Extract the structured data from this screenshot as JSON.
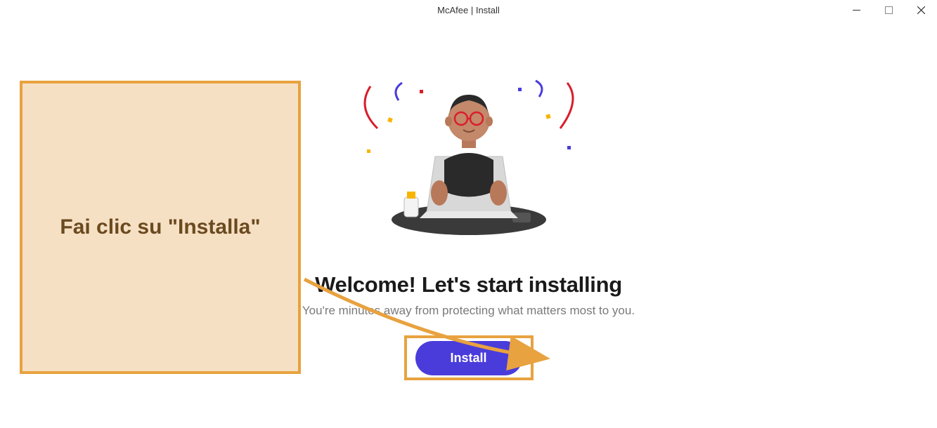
{
  "window": {
    "title": "McAfee | Install"
  },
  "main": {
    "heading": "Welcome! Let's start installing",
    "subheading": "You're minutes away from protecting what matters most to you.",
    "install_label": "Install"
  },
  "callout": {
    "text": "Fai clic su \"Installa\""
  },
  "colors": {
    "primary": "#4a3cdb",
    "highlight": "#e8a23f",
    "callout_bg": "#f6e0c4",
    "callout_text": "#6b4a1f"
  }
}
